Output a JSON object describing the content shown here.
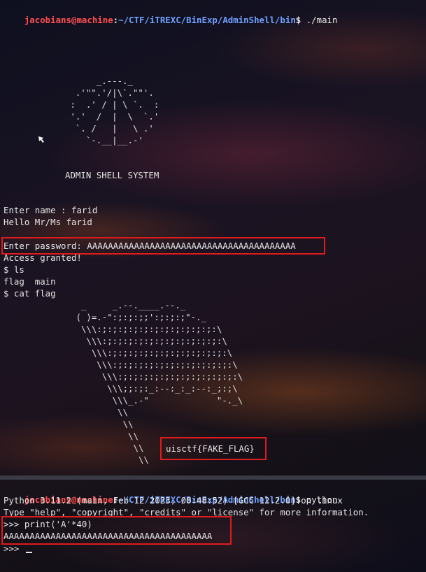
{
  "top_terminal": {
    "prompt": {
      "user_host": "jacobians@machine",
      "separator": ":",
      "path": "~/CTF/iTREXC/BinExp/AdminShell/bin",
      "symbol": "$",
      "command": "./main"
    },
    "banner_art": "      _.---._\n  .'\"\".'/|\\`.\"\"'.\n :  .' / | \\ `.  :\n '.'  /  |  \\  `.'\n  `. /   |   \\ .'\n    `-.__|__.-'",
    "banner_title": "ADMIN SHELL SYSTEM",
    "lines": [
      "Enter name : farid",
      "Hello Mr/Ms farid",
      "",
      "Enter password: AAAAAAAAAAAAAAAAAAAAAAAAAAAAAAAAAAAAAAAA",
      "Access granted!",
      "$ ls",
      "flag  main",
      "$ cat flag"
    ],
    "flag_art": "  _     _.--.____.--._\n ( )=.-\":;:;:;;':;:;:;\"-._\n  \\\\\\:;:;:;:;:;:;:;:;:;:;:;:\\\n   \\\\\\:;:;:;:;:;:;:;:;:;:;:;:\\\n    \\\\\\:;:;:;:;:;:;:;:;:;:;:;:\\\n     \\\\\\:;:;:;:;:;:;:;:;:;:;:;:\\\n      \\\\\\:;:;:;:;:;:;:;:;:;:;:;:\\\n       \\\\\\;;:;:_:--:_:_:--:_;:;\\\n        \\\\\\_.-\"             \"-._\\\n         \\\\\n          \\\\\n           \\\\\n            \\\\\n             \\\\",
    "flag_value": "uisctf{FAKE_FLAG}"
  },
  "bottom_terminal": {
    "prompt": {
      "user_host": "jacobians@machine",
      "separator": ":",
      "path": "~/CTF/iTREXC/BinExp/AdminShell/bin",
      "symbol": "$",
      "command": "python"
    },
    "lines": [
      "Python 3.11.2 (main, Feb 12 2023, 00:48:52) [GCC 12.2.0] on linux",
      "Type \"help\", \"copyright\", \"credits\" or \"license\" for more information.",
      ">>> print('A'*40)",
      "AAAAAAAAAAAAAAAAAAAAAAAAAAAAAAAAAAAAAAAA"
    ],
    "repl_prompt": ">>> "
  },
  "colors": {
    "user": "#ff4f4f",
    "path": "#6fa0ff",
    "highlight": "#e01b1b",
    "text": "#e6e6e6"
  }
}
